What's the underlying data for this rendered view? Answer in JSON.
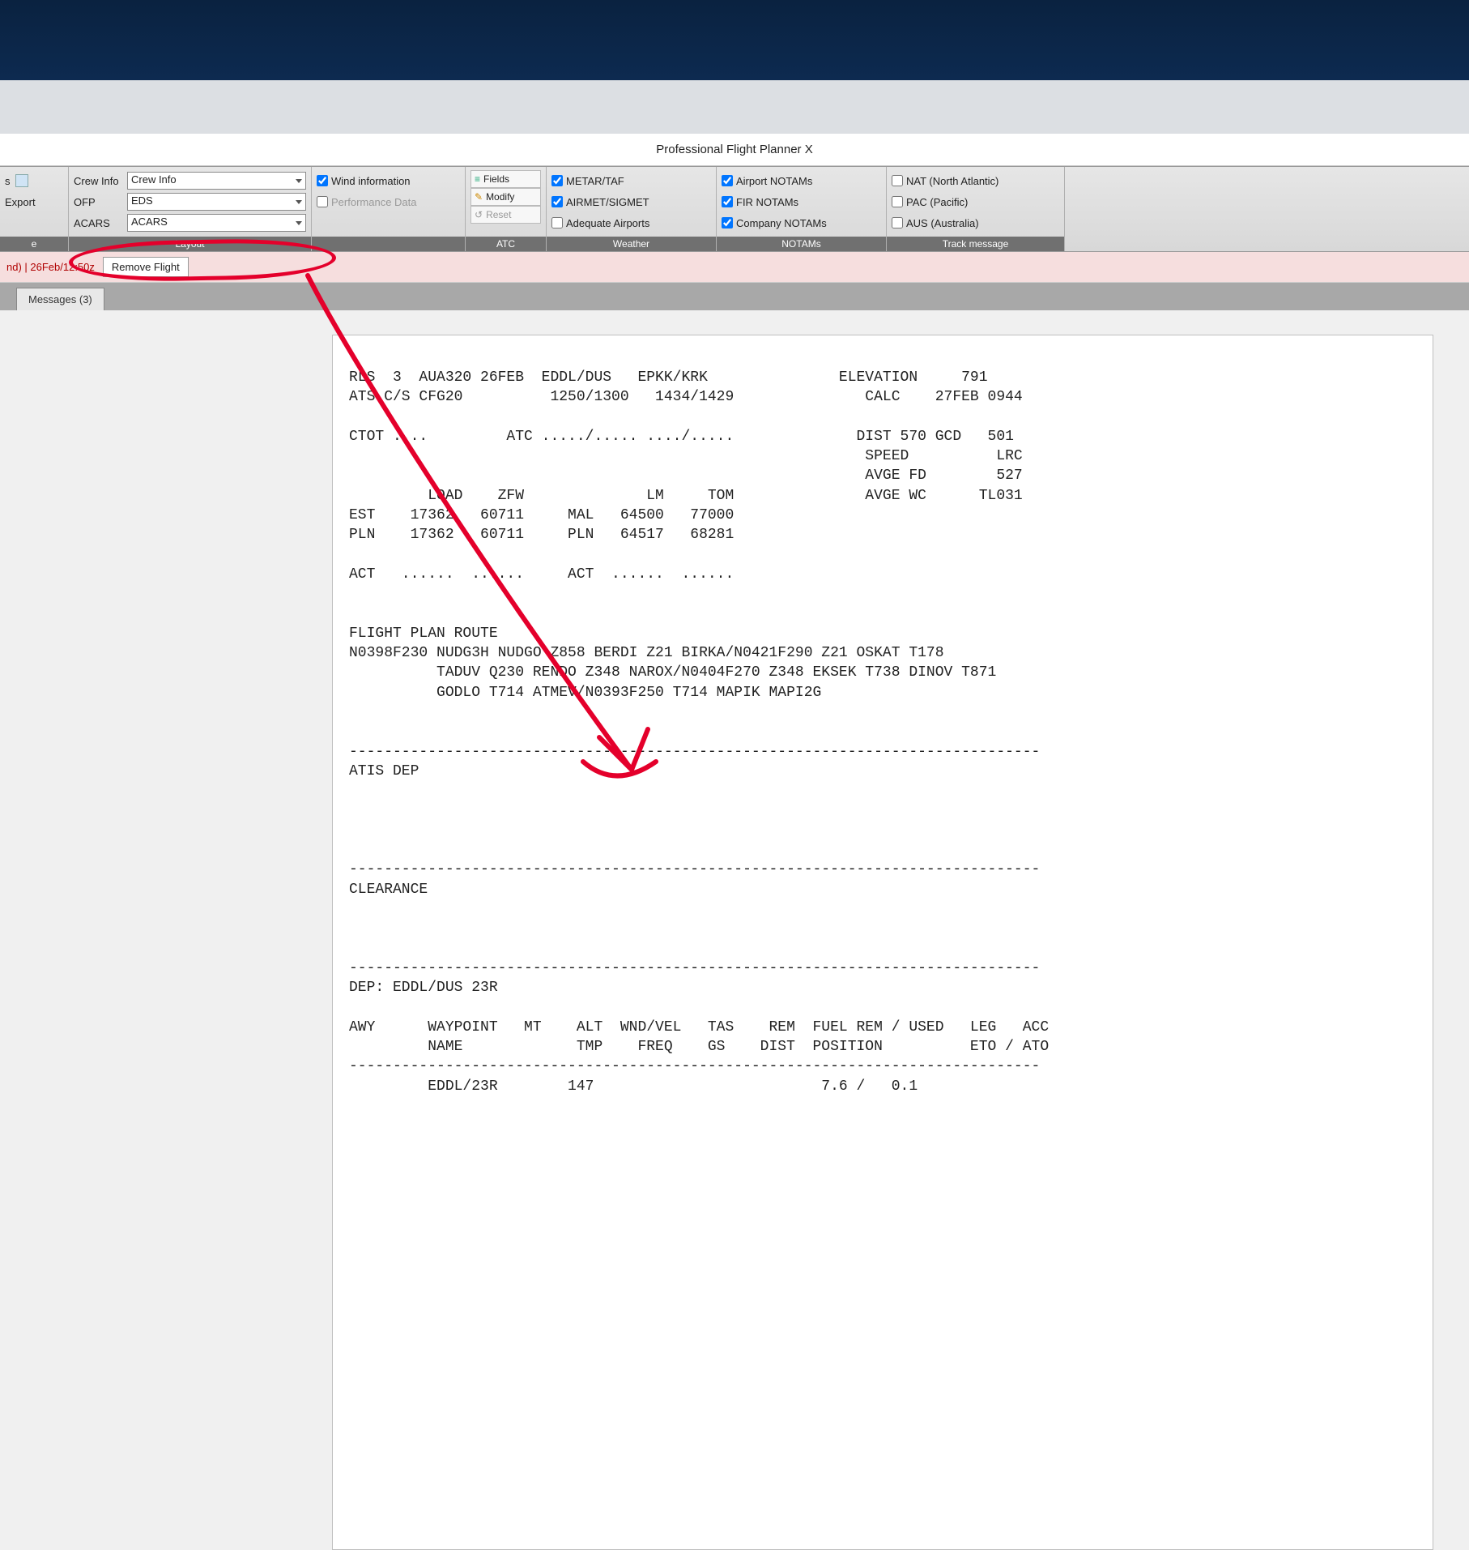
{
  "app_title": "Professional Flight Planner X",
  "ribbon": {
    "left_stub": "s",
    "export_label": "Export",
    "crew_info_lbl": "Crew Info",
    "crew_info_val": "Crew Info",
    "ofp_lbl": "OFP",
    "ofp_val": "EDS",
    "acars_lbl": "ACARS",
    "acars_val": "ACARS",
    "layout_title": "Layout",
    "wind_info": "Wind information",
    "perf_data": "Performance Data",
    "fields": "Fields",
    "modify": "Modify",
    "reset": "Reset",
    "atc_title": "ATC",
    "metar_taf": "METAR/TAF",
    "airmet_sigmet": "AIRMET/SIGMET",
    "adequate_airports": "Adequate Airports",
    "weather_title": "Weather",
    "airport_notams": "Airport NOTAMs",
    "fir_notams": "FIR NOTAMs",
    "company_notams": "Company NOTAMs",
    "notams_title": "NOTAMs",
    "nat": "NAT (North Atlantic)",
    "pac": "PAC (Pacific)",
    "aus": "AUS (Australia)",
    "track_title": "Track message"
  },
  "status": {
    "text": "nd) | 26Feb/12:50z",
    "remove_btn": "Remove Flight"
  },
  "tabs": {
    "messages": "Messages (3)"
  },
  "ofp_text": "RLS  3  AUA320 26FEB  EDDL/DUS   EPKK/KRK               ELEVATION     791\nATS C/S CFG20          1250/1300   1434/1429               CALC    27FEB 0944\n\nCTOT ....         ATC ...../..... ..../.....              DIST 570 GCD   501\n                                                           SPEED          LRC\n                                                           AVGE FD        527\n         LOAD    ZFW              LM     TOM               AVGE WC      TL031\nEST    17362   60711     MAL   64500   77000\nPLN    17362   60711     PLN   64517   68281\n\nACT   ......  ......     ACT  ......  ......\n\n\nFLIGHT PLAN ROUTE\nN0398F230 NUDG3H NUDGO Z858 BERDI Z21 BIRKA/N0421F290 Z21 OSKAT T178\n          TADUV Q230 RENDO Z348 NAROX/N0404F270 Z348 EKSEK T738 DINOV T871\n          GODLO T714 ATMEV/N0393F250 T714 MAPIK MAPI2G\n\n\n-------------------------------------------------------------------------------\nATIS DEP\n\n\n\n\n-------------------------------------------------------------------------------\nCLEARANCE\n\n\n\n-------------------------------------------------------------------------------\nDEP: EDDL/DUS 23R\n\nAWY      WAYPOINT   MT    ALT  WND/VEL   TAS    REM  FUEL REM / USED   LEG   ACC\n         NAME             TMP    FREQ    GS    DIST  POSITION          ETO / ATO\n-------------------------------------------------------------------------------\n         EDDL/23R        147                          7.6 /   0.1"
}
